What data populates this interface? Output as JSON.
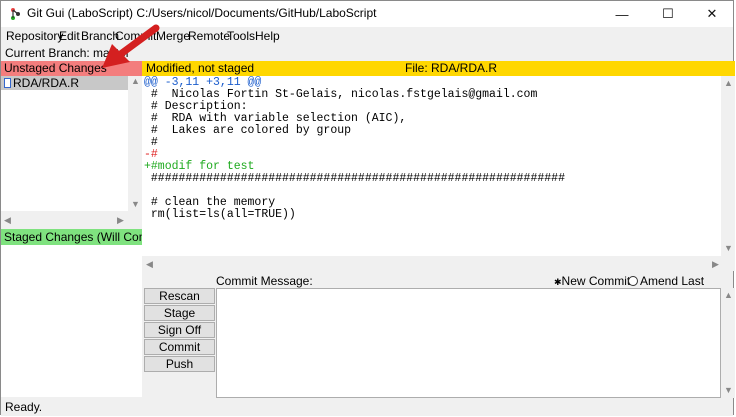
{
  "window": {
    "title": "Git Gui (LaboScript) C:/Users/nicol/Documents/GitHub/LaboScript",
    "minimize": "—",
    "maximize": "☐",
    "close": "✕"
  },
  "menu": [
    "Repository",
    "Edit",
    "Branch",
    "Commit",
    "Merge",
    "Remote",
    "Tools",
    "Help"
  ],
  "branch": {
    "label": "Current Branch: master"
  },
  "unstaged": {
    "header": "Unstaged Changes",
    "files": [
      "RDA/RDA.R"
    ]
  },
  "staged": {
    "header": "Staged Changes (Will Commit)"
  },
  "diff": {
    "status": "Modified, not staged",
    "file": "File: RDA/RDA.R",
    "lines": [
      {
        "text": "@@ -3,11 +3,11 @@",
        "color": "#1a5ccc"
      },
      {
        "text": " #  Nicolas Fortin St-Gelais, nicolas.fstgelais@gmail.com",
        "color": "#000000"
      },
      {
        "text": " # Description:",
        "color": "#000000"
      },
      {
        "text": " #  RDA with variable selection (AIC),",
        "color": "#000000"
      },
      {
        "text": " #  Lakes are colored by group",
        "color": "#000000"
      },
      {
        "text": " #",
        "color": "#000000"
      },
      {
        "text": "-#",
        "color": "#e02020"
      },
      {
        "text": "+#modif for test",
        "color": "#1faa1f"
      },
      {
        "text": " ############################################################",
        "color": "#000000"
      },
      {
        "text": "",
        "color": "#000000"
      },
      {
        "text": " # clean the memory",
        "color": "#000000"
      },
      {
        "text": " rm(list=ls(all=TRUE))",
        "color": "#000000"
      }
    ]
  },
  "commit": {
    "label": "Commit Message:",
    "new_commit": "New Commit",
    "amend": "Amend Last Commit",
    "buttons": [
      "Rescan",
      "Stage Changed",
      "Sign Off",
      "Commit",
      "Push"
    ]
  },
  "status": "Ready.",
  "colors": {
    "unstaged": "#f37d7d",
    "staged": "#7fe27f",
    "diff_header": "#ffd700",
    "annotation_arrow": "#d42020"
  }
}
